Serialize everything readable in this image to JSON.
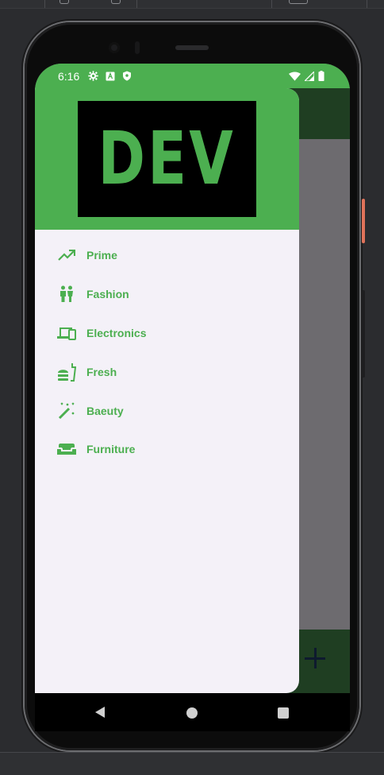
{
  "status": {
    "time": "6:16",
    "left_icons": [
      "settings-icon",
      "a-icon",
      "shield-icon"
    ],
    "right_icons": [
      "wifi-icon",
      "signal-icon",
      "battery-icon"
    ]
  },
  "drawer": {
    "logo_text": "DEV",
    "items": [
      {
        "label": "Prime",
        "icon": "trending-up-icon"
      },
      {
        "label": "Fashion",
        "icon": "people-icon"
      },
      {
        "label": "Electronics",
        "icon": "devices-icon"
      },
      {
        "label": "Fresh",
        "icon": "fastfood-icon"
      },
      {
        "label": "Baeuty",
        "icon": "magic-wand-icon"
      },
      {
        "label": "Furniture",
        "icon": "sofa-icon"
      }
    ]
  },
  "fab": {
    "icon": "plus-icon"
  },
  "nav": {
    "icons": [
      "back-icon",
      "home-icon",
      "recents-icon"
    ]
  },
  "colors": {
    "accent": "#4caf50",
    "app_bar": "#1f3e22",
    "drawer_bg": "#f4f1f8",
    "scrim": "#6d6b6f"
  }
}
